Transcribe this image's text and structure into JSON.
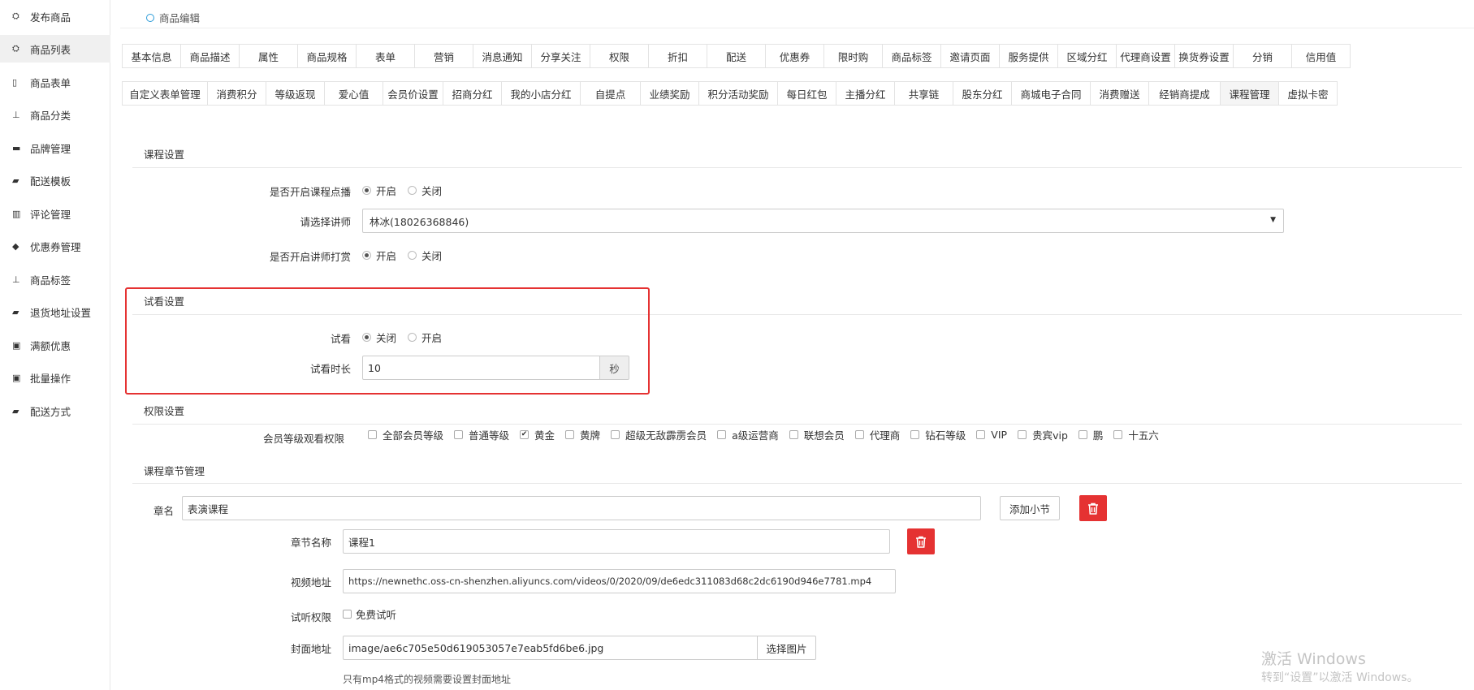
{
  "sidebar": {
    "items": [
      {
        "label": "发布商品",
        "icon": "cubes-icon"
      },
      {
        "label": "商品列表",
        "icon": "cubes-icon"
      },
      {
        "label": "商品表单",
        "icon": "file-icon"
      },
      {
        "label": "商品分类",
        "icon": "sitemap-icon"
      },
      {
        "label": "品牌管理",
        "icon": "briefcase-icon"
      },
      {
        "label": "配送模板",
        "icon": "truck-icon"
      },
      {
        "label": "评论管理",
        "icon": "columns-icon"
      },
      {
        "label": "优惠券管理",
        "icon": "tags-icon"
      },
      {
        "label": "商品标签",
        "icon": "sitemap-icon"
      },
      {
        "label": "退货地址设置",
        "icon": "truck-icon"
      },
      {
        "label": "满额优惠",
        "icon": "gift-icon"
      },
      {
        "label": "批量操作",
        "icon": "gift-icon"
      },
      {
        "label": "配送方式",
        "icon": "truck-icon"
      }
    ]
  },
  "breadcrumb": {
    "title": "商品编辑"
  },
  "tabs_row1": [
    "基本信息",
    "商品描述",
    "属性",
    "商品规格",
    "表单",
    "营销",
    "消息通知",
    "分享关注",
    "权限",
    "折扣",
    "配送",
    "优惠券",
    "限时购",
    "商品标签",
    "邀请页面",
    "服务提供",
    "区域分红",
    "代理商设置",
    "换货券设置",
    "分销",
    "信用值"
  ],
  "tabs_row2": [
    "自定义表单管理",
    "消费积分",
    "等级返现",
    "爱心值",
    "会员价设置",
    "招商分红",
    "我的小店分红",
    "自提点",
    "业绩奖励",
    "积分活动奖励",
    "每日红包",
    "主播分红",
    "共享链",
    "股东分红",
    "商城电子合同",
    "消费赠送",
    "经销商提成",
    "课程管理",
    "虚拟卡密"
  ],
  "course": {
    "title": "课程设置",
    "vod_label": "是否开启课程点播",
    "vod_on": "开启",
    "vod_off": "关闭",
    "teacher_label": "请选择讲师",
    "teacher_value": "林冰(18026368846)",
    "tip_label": "是否开启讲师打赏",
    "tip_on": "开启",
    "tip_off": "关闭"
  },
  "trial": {
    "title": "试看设置",
    "label": "试看",
    "off": "关闭",
    "on": "开启",
    "duration_label": "试看时长",
    "duration_value": "10",
    "unit": "秒"
  },
  "permission": {
    "title": "权限设置",
    "label": "会员等级观看权限",
    "levels": [
      {
        "name": "全部会员等级",
        "checked": false
      },
      {
        "name": "普通等级",
        "checked": false
      },
      {
        "name": "黄金",
        "checked": true
      },
      {
        "name": "黄牌",
        "checked": false
      },
      {
        "name": "超级无敌霹雳会员",
        "checked": false
      },
      {
        "name": "a级运营商",
        "checked": false
      },
      {
        "name": "联想会员",
        "checked": false
      },
      {
        "name": "代理商",
        "checked": false
      },
      {
        "name": "钻石等级",
        "checked": false
      },
      {
        "name": "VIP",
        "checked": false
      },
      {
        "name": "贵宾vip",
        "checked": false
      },
      {
        "name": "鹏",
        "checked": false
      },
      {
        "name": "十五六",
        "checked": false
      }
    ]
  },
  "chapter": {
    "title": "课程章节管理",
    "name_label": "章名",
    "name_value": "表演课程",
    "add_section": "添加小节",
    "section_name_label": "章节名称",
    "section_name_value": "课程1",
    "video_label": "视频地址",
    "video_value": "https://newnethc.oss-cn-shenzhen.aliyuncs.com/videos/0/2020/09/de6edc311083d68c2dc6190d946e7781.mp4",
    "trial_perm_label": "试听权限",
    "free_trial": "免费试听",
    "cover_label": "封面地址",
    "cover_value": "image/ae6c705e50d619053057e7eab5fd6be6.jpg",
    "choose_image": "选择图片",
    "help": "只有mp4格式的视频需要设置封面地址"
  },
  "watermark": {
    "line1": "激活 Windows",
    "line2": "转到“设置”以激活 Windows。"
  },
  "colors": {
    "accent": "#2b9bd8",
    "danger": "#e53232"
  }
}
